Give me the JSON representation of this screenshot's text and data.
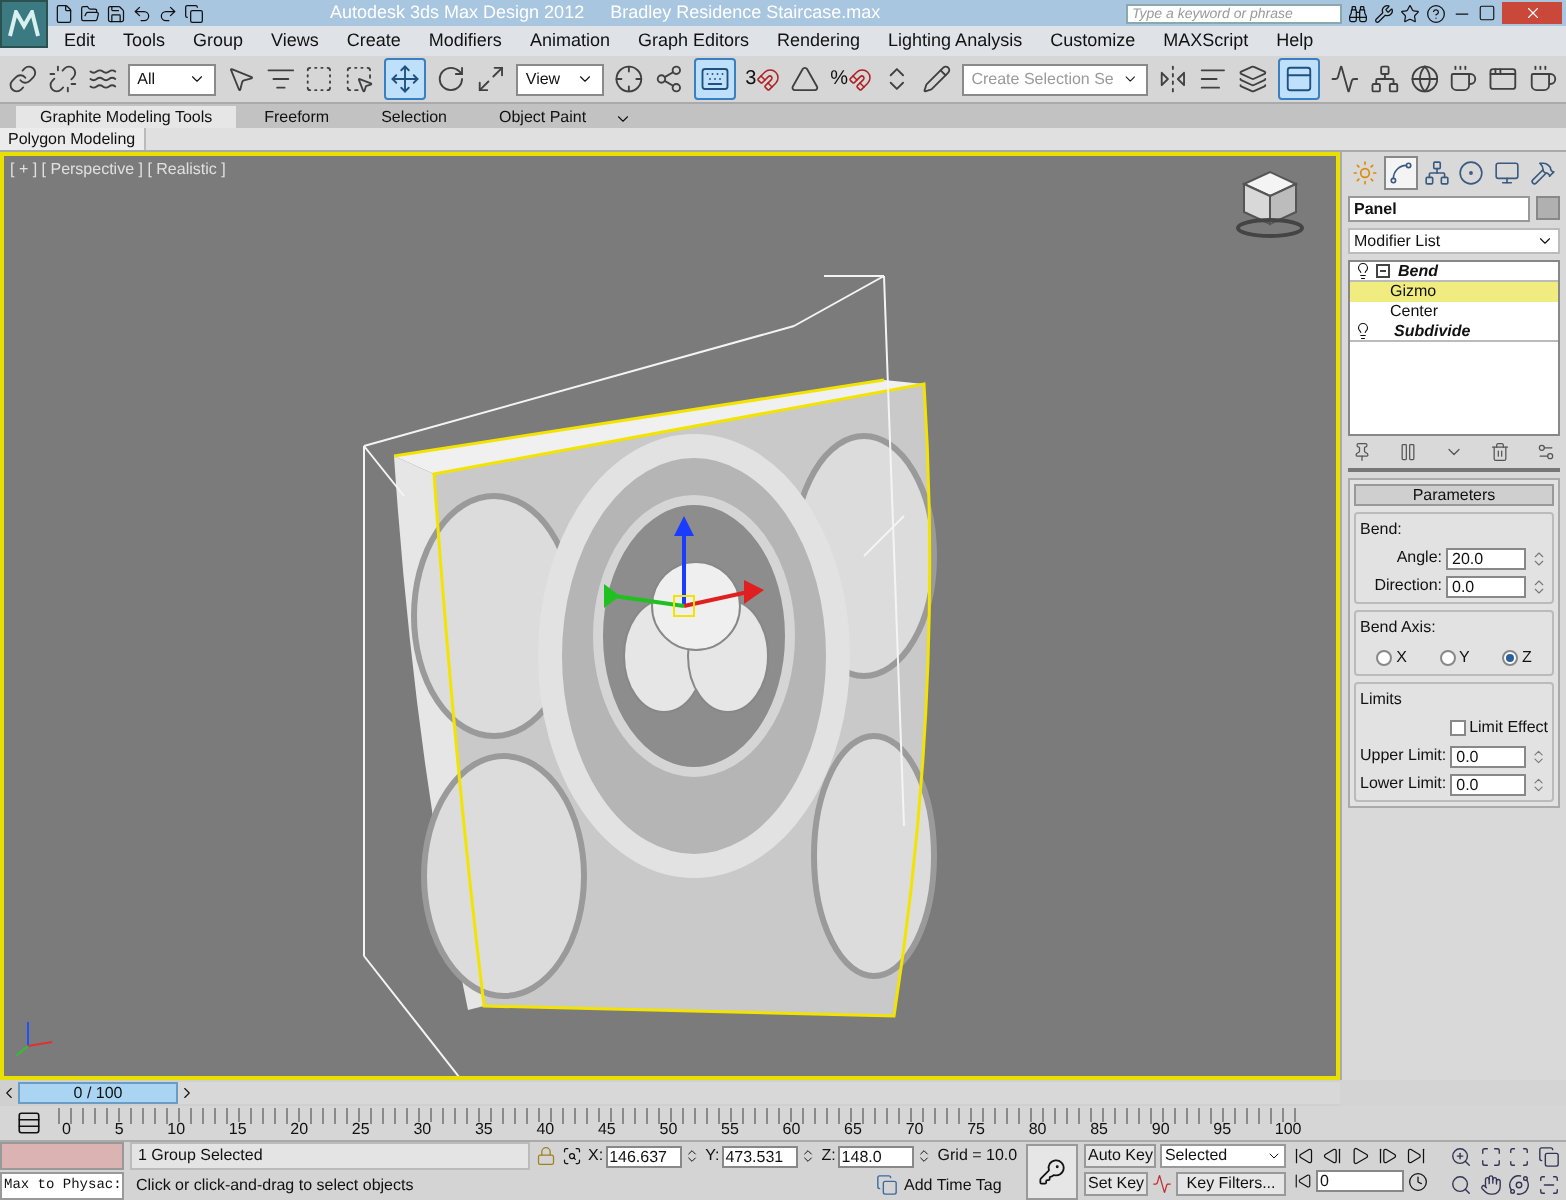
{
  "window": {
    "title": "Autodesk 3ds Max Design 2012",
    "document": "Bradley Residence Staircase.max",
    "search": {
      "placeholder": "Type a keyword or phrase"
    }
  },
  "menu": [
    "Edit",
    "Tools",
    "Group",
    "Views",
    "Create",
    "Modifiers",
    "Animation",
    "Graph Editors",
    "Rendering",
    "Lighting Analysis",
    "Customize",
    "MAXScript",
    "Help"
  ],
  "toolbar": [
    {
      "kind": "link",
      "selected": false
    },
    {
      "kind": "unlink",
      "selected": false
    },
    {
      "kind": "bind",
      "selected": false
    },
    {
      "kind": "dropdown",
      "value": "All"
    },
    {
      "kind": "select",
      "selected": false
    },
    {
      "kind": "select_by_name",
      "selected": false
    },
    {
      "kind": "region",
      "selected": false
    },
    {
      "kind": "crossing",
      "selected": false
    },
    {
      "kind": "move",
      "selected": true
    },
    {
      "kind": "rotate",
      "selected": false
    },
    {
      "kind": "scale",
      "selected": false
    },
    {
      "kind": "dropdown",
      "value": "View"
    },
    {
      "kind": "pivot",
      "selected": false
    },
    {
      "kind": "manipulate",
      "selected": false
    },
    {
      "kind": "keyboard",
      "selected": true
    },
    {
      "kind": "snap",
      "label": "3"
    },
    {
      "kind": "angle_snap",
      "selected": false
    },
    {
      "kind": "snap",
      "label": "%"
    },
    {
      "kind": "spinner_snap",
      "selected": false
    },
    {
      "kind": "edit_named",
      "selected": false
    },
    {
      "kind": "dropdown",
      "placeholder": "Create Selection Se"
    },
    {
      "kind": "mirror",
      "selected": false
    },
    {
      "kind": "align",
      "selected": false
    },
    {
      "kind": "layers",
      "selected": false
    },
    {
      "kind": "ribbon",
      "selected": true
    },
    {
      "kind": "curve_editor",
      "selected": false
    },
    {
      "kind": "schematic",
      "selected": false
    },
    {
      "kind": "material",
      "selected": false
    },
    {
      "kind": "render_setup",
      "selected": false
    },
    {
      "kind": "frame_window",
      "selected": false
    },
    {
      "kind": "render",
      "selected": false
    }
  ],
  "ribbon": {
    "tabs": [
      {
        "label": "Graphite Modeling Tools",
        "selected": true
      },
      {
        "label": "Freeform",
        "selected": false
      },
      {
        "label": "Selection",
        "selected": false
      },
      {
        "label": "Object Paint",
        "selected": false
      }
    ],
    "panel": "Polygon Modeling"
  },
  "viewport": {
    "label": "[ + ] [ Perspective ] [ Realistic ]"
  },
  "command_panel": {
    "tabs": [
      {
        "kind": "create",
        "selected": false
      },
      {
        "kind": "modify",
        "selected": true
      },
      {
        "kind": "hierarchy",
        "selected": false
      },
      {
        "kind": "motion",
        "selected": false
      },
      {
        "kind": "display",
        "selected": false
      },
      {
        "kind": "utilities",
        "selected": false
      }
    ],
    "object_name": "Panel",
    "modifier_list": "Modifier List",
    "stack": [
      {
        "label": "Bend",
        "expanded": true,
        "selected": false,
        "children": [
          {
            "label": "Gizmo",
            "selected": true
          },
          {
            "label": "Center",
            "selected": false
          }
        ]
      },
      {
        "label": "Subdivide",
        "selected": false
      }
    ],
    "parameters": {
      "title": "Parameters",
      "bend": {
        "label": "Bend:",
        "fields": [
          {
            "label": "Angle:",
            "value": "20.0"
          },
          {
            "label": "Direction:",
            "value": "0.0"
          }
        ]
      },
      "axis": {
        "label": "Bend Axis:",
        "options": [
          {
            "label": "X",
            "selected": false
          },
          {
            "label": "Y",
            "selected": false
          },
          {
            "label": "Z",
            "selected": true
          }
        ]
      },
      "limits": {
        "label": "Limits",
        "checkbox": {
          "label": "Limit Effect",
          "checked": false
        },
        "fields": [
          {
            "label": "Upper Limit:",
            "value": "0.0"
          },
          {
            "label": "Lower Limit:",
            "value": "0.0"
          }
        ]
      }
    }
  },
  "timeline": {
    "frame": "0 / 100",
    "level": 0,
    "ticks": [
      "0",
      "5",
      "10",
      "15",
      "20",
      "25",
      "30",
      "35",
      "40",
      "45",
      "50",
      "55",
      "60",
      "65",
      "70",
      "75",
      "80",
      "85",
      "90",
      "95",
      "100"
    ]
  },
  "status": {
    "listener": "Max to Physac:",
    "selection": "1 Group Selected",
    "prompt": "Click or click-and-drag to select objects",
    "coords": [
      {
        "axis": "X:",
        "value": "146.637"
      },
      {
        "axis": "Y:",
        "value": "473.531"
      },
      {
        "axis": "Z:",
        "value": "148.0"
      }
    ],
    "grid": "Grid = 10.0",
    "time_tag": "Add Time Tag",
    "auto_key": "Auto Key",
    "set_key": "Set Key",
    "key_mode": "Selected",
    "key_filters": "Key Filters...",
    "frame": "0"
  }
}
